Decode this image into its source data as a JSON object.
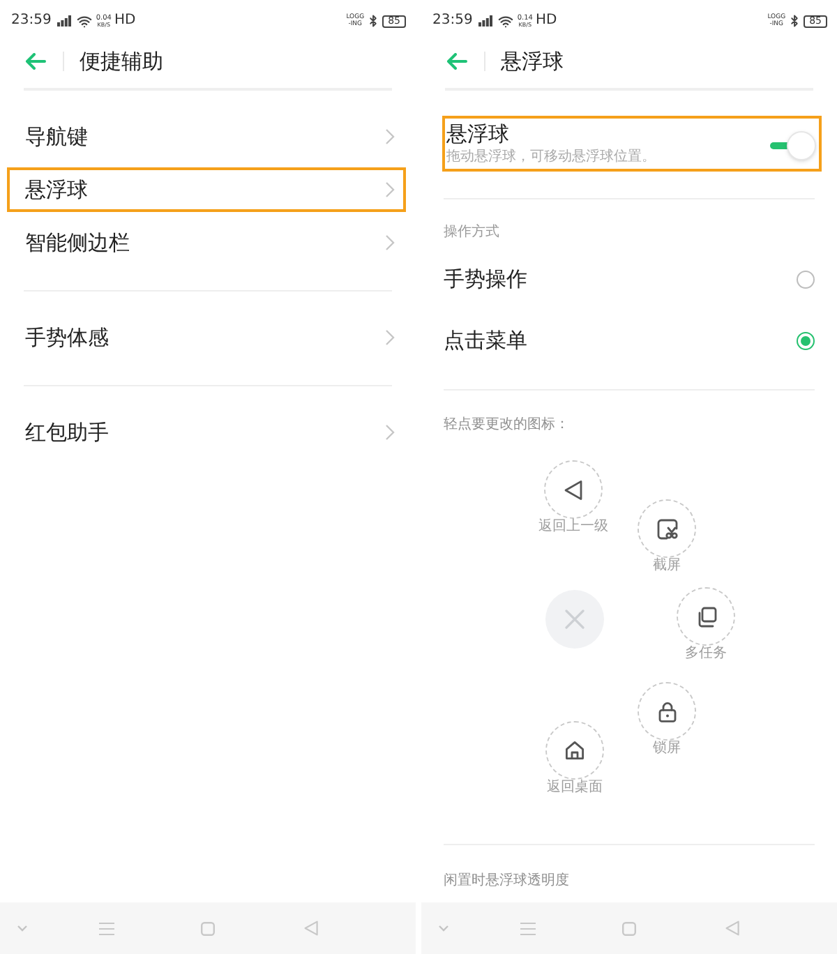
{
  "screens": [
    {
      "kind": "menu",
      "status_bar": {
        "time": "23:59",
        "speed": "0.04",
        "speed_unit": "KB/S",
        "network": "HD",
        "log_line_1": "LOGG",
        "log_line_2": "-ING",
        "battery": "85"
      },
      "title": "便捷辅助",
      "item_groups": [
        {
          "items": [
            {
              "label": "导航键",
              "highlighted": false
            },
            {
              "label": "悬浮球",
              "highlighted": true
            },
            {
              "label": "智能侧边栏",
              "highlighted": false
            }
          ]
        },
        {
          "items": [
            {
              "label": "手势体感",
              "highlighted": false
            }
          ]
        },
        {
          "items": [
            {
              "label": "红包助手",
              "highlighted": false
            }
          ]
        }
      ]
    },
    {
      "kind": "detail",
      "status_bar": {
        "time": "23:59",
        "speed": "0.14",
        "speed_unit": "KB/S",
        "network": "HD",
        "log_line_1": "LOGG",
        "log_line_2": "-ING",
        "battery": "85"
      },
      "title": "悬浮球",
      "toggle": {
        "label": "悬浮球",
        "description": "拖动悬浮球，可移动悬浮球位置。",
        "on": true,
        "highlighted": true
      },
      "mode_section": {
        "label": "操作方式",
        "options": [
          {
            "label": "手势操作",
            "selected": false
          },
          {
            "label": "点击菜单",
            "selected": true
          }
        ]
      },
      "icon_section": {
        "label": "轻点要更改的图标：",
        "shortcuts": [
          {
            "kind": "back",
            "label": "返回上一级"
          },
          {
            "kind": "screenshot",
            "label": "截屏"
          },
          {
            "kind": "close"
          },
          {
            "kind": "multitask",
            "label": "多任务"
          },
          {
            "kind": "lock",
            "label": "锁屏"
          },
          {
            "kind": "home",
            "label": "返回桌面"
          }
        ]
      },
      "footer_label": "闲置时悬浮球透明度"
    }
  ]
}
